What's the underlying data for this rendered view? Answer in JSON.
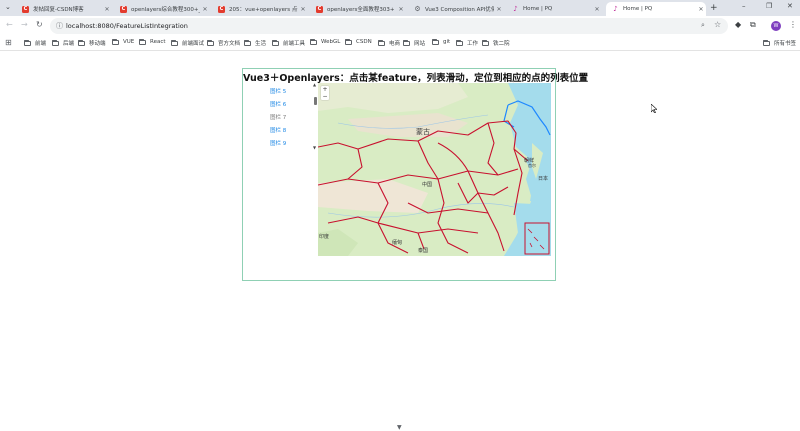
{
  "browser": {
    "tabs": [
      {
        "favicon": "csdn-icon",
        "title": "发帖回复-CSDN博客",
        "active": false
      },
      {
        "favicon": "csdn-icon",
        "title": "openlayers综合教程300+_近乎全网",
        "active": false
      },
      {
        "favicon": "csdn-icon",
        "title": "205：vue+openlayers 点击列...",
        "active": false
      },
      {
        "favicon": "csdn-icon",
        "title": "openlayers全面教程303+【实...",
        "active": false
      },
      {
        "favicon": "gear-icon",
        "title": "Vue3 Composition API优化...",
        "active": false
      },
      {
        "favicon": "pq-icon",
        "title": "Home | PQ",
        "active": false
      },
      {
        "favicon": "pq-icon",
        "title": "Home | PQ",
        "active": true
      }
    ],
    "new_tab": "+",
    "window_controls": {
      "minimize": "–",
      "restore": "❐",
      "close": "✕"
    },
    "url": "localhost:8080/FeatureListIntegration",
    "avatar_initial": "W",
    "bookmarks": [
      "前端",
      "后端",
      "移动端",
      "VUE",
      "React",
      "前端面试",
      "官方文档",
      "生活",
      "前端工具",
      "WebGL",
      "CSDN",
      "电商",
      "网站",
      "git",
      "工作",
      "铁二院"
    ],
    "all_bookmarks_label": "所有书签"
  },
  "page": {
    "title": "Vue3＋Openlayers：点击某feature，列表滑动，定位到相应的点的列表位置",
    "list_items": [
      "图栏 5",
      "图栏 6",
      "图栏 7",
      "图栏 8",
      "图栏 9"
    ],
    "selected_index": 2,
    "map": {
      "zoom_in": "+",
      "zoom_out": "−",
      "labels": [
        "蒙古",
        "中国",
        "印度",
        "朝鲜",
        "日本",
        "缅甸",
        "泰国",
        "首尔"
      ]
    }
  },
  "colors": {
    "frame_border": "#8fd0b4",
    "list_link": "#1e88e5",
    "boundary": "#c8102e",
    "water": "#a4dcec"
  }
}
